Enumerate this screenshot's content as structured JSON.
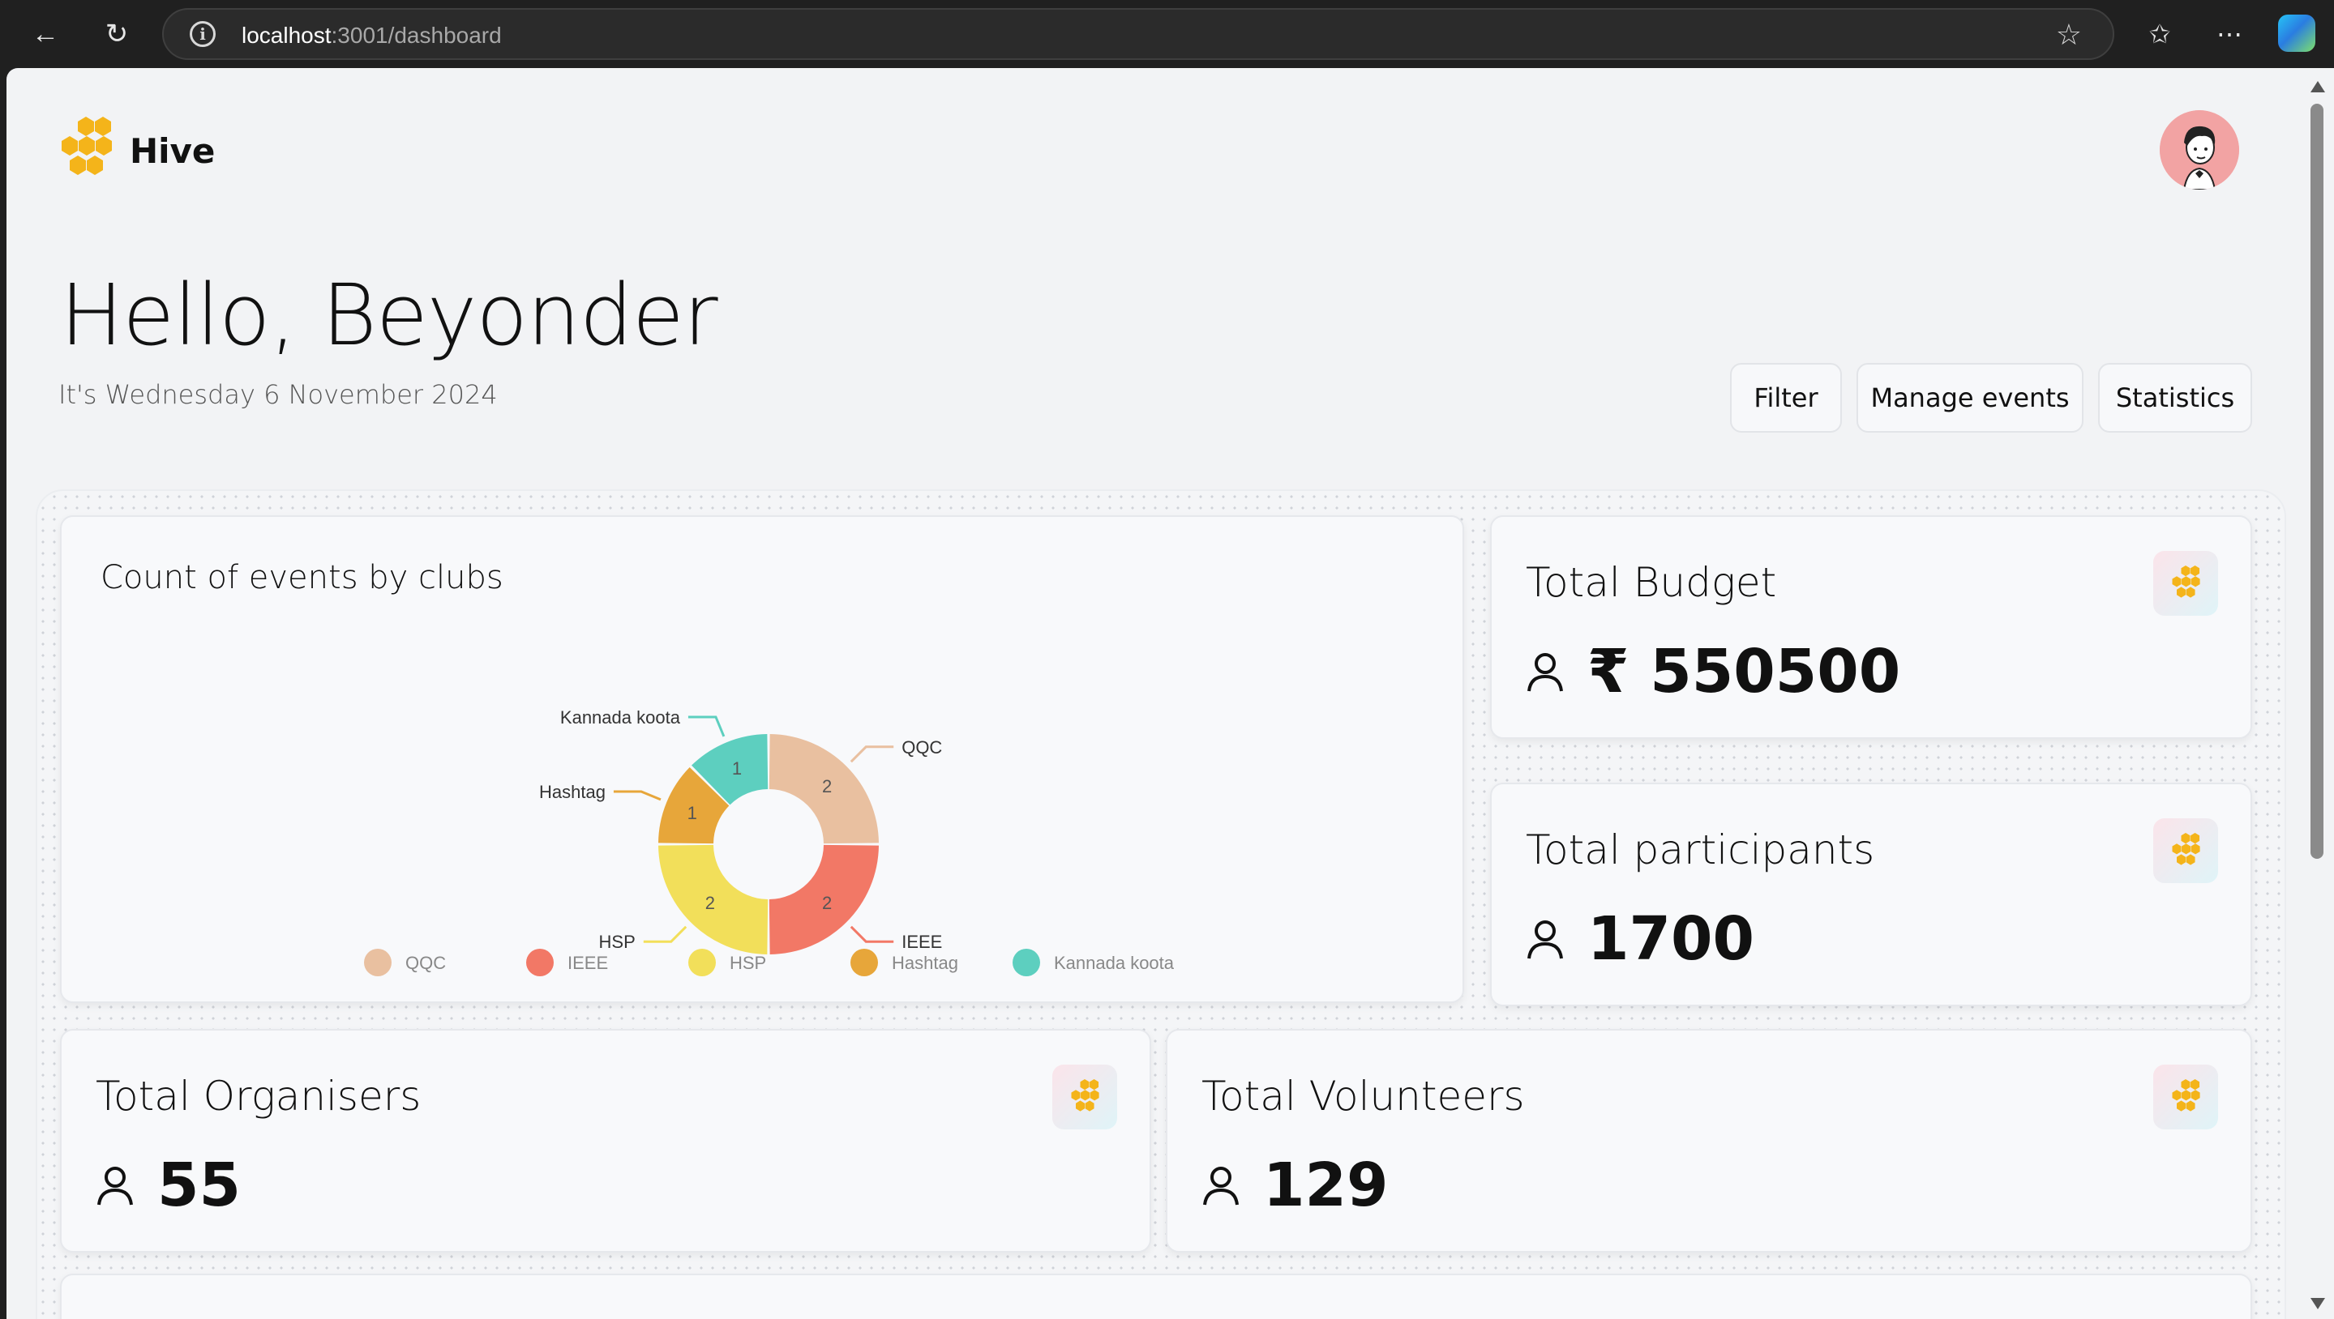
{
  "browser": {
    "url_host": "localhost",
    "url_path": ":3001/dashboard"
  },
  "app": {
    "brand": "Hive"
  },
  "header": {
    "greeting": "Hello, Beyonder",
    "date": "It's Wednesday 6 November 2024"
  },
  "actions": {
    "filter": "Filter",
    "manage_events": "Manage events",
    "statistics": "Statistics"
  },
  "cards": {
    "budget": {
      "title": "Total Budget",
      "value": "₹ 550500"
    },
    "participants": {
      "title": "Total participants",
      "value": "1700"
    },
    "organisers": {
      "title": "Total Organisers",
      "value": "55"
    },
    "volunteers": {
      "title": "Total Volunteers",
      "value": "129"
    }
  },
  "chart_data": {
    "type": "pie",
    "title": "Count of events by clubs",
    "categories": [
      "QQC",
      "IEEE",
      "HSP",
      "Hashtag",
      "Kannada koota"
    ],
    "values": [
      2,
      2,
      2,
      1,
      1
    ],
    "colors": [
      "#e9c0a0",
      "#f27866",
      "#f2df5a",
      "#e7a63a",
      "#5dcfbf"
    ],
    "legend_position": "bottom"
  }
}
